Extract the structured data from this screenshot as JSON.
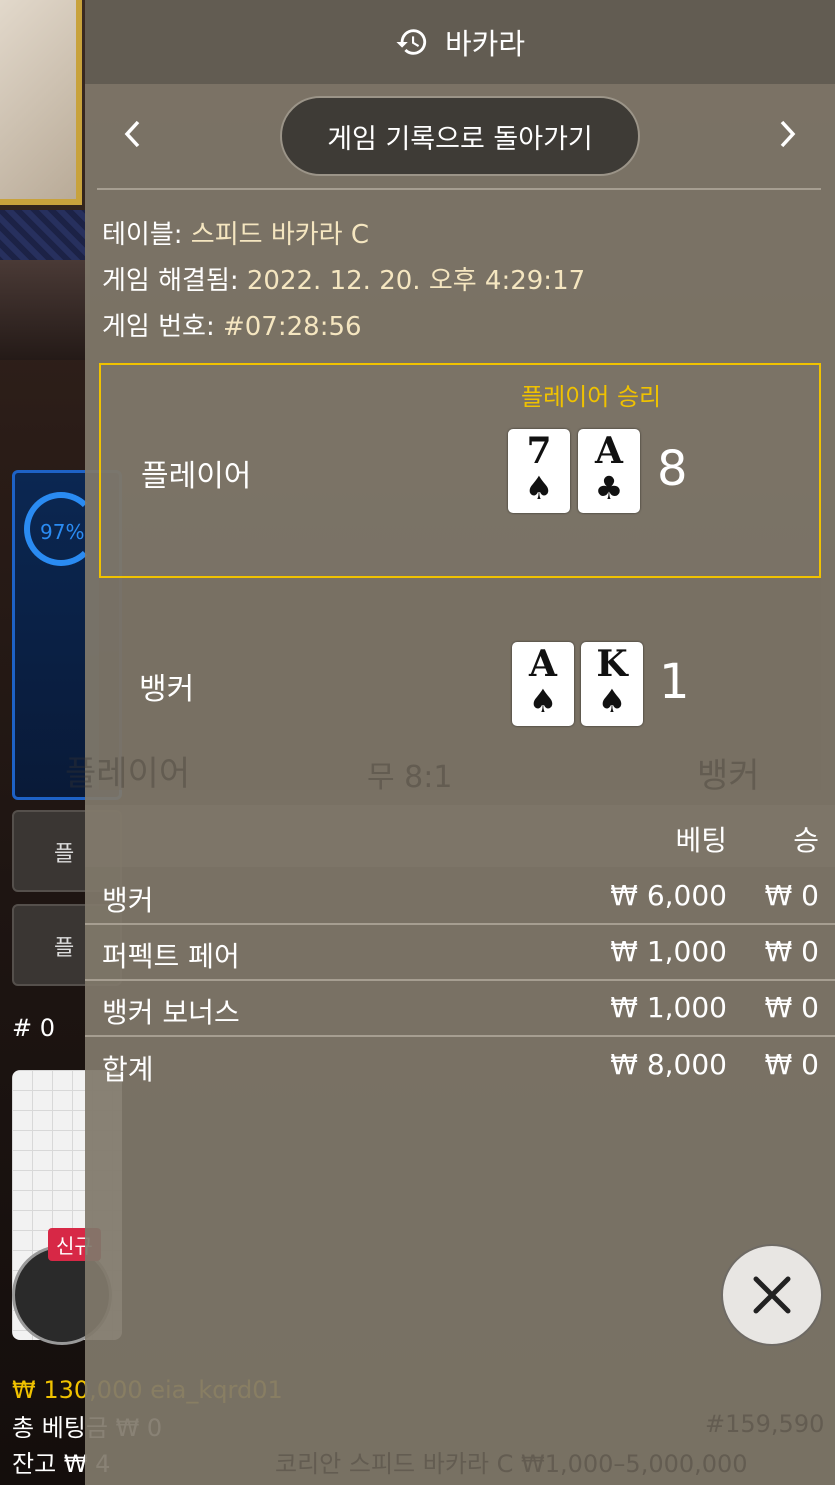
{
  "background": {
    "percent": "97%",
    "side_buttons": [
      "플레이어 보너스",
      "플레이어 페어"
    ],
    "hash_label": "# 0",
    "new_tag": "신규",
    "balance_line": "₩ 130,000 eia_kqrd01",
    "total_bet_line": "총 베팅금 ₩ 0",
    "remaining_line": "잔고 ₩ 4",
    "ghost_texts": {
      "player": "플레이어",
      "tie": "무 8:1",
      "banker": "뱅커",
      "table_limit": "코리안 스피드 바카라 C ₩1,000–5,000,000",
      "game_no": "#159,590"
    }
  },
  "panel": {
    "title": "바카라",
    "title_icon": "history-icon",
    "back_button_label": "게임 기록으로 돌아가기",
    "info": [
      {
        "label": "테이블:",
        "value": "스피드 바카라 C"
      },
      {
        "label": "게임 해결됨:",
        "value": "2022. 12. 20. 오후 4:29:17"
      },
      {
        "label": "게임 번호:",
        "value": "#07:28:56"
      }
    ],
    "player": {
      "label": "플레이어",
      "result": "플레이어 승리",
      "cards": [
        {
          "rank": "7",
          "suit": "♠"
        },
        {
          "rank": "A",
          "suit": "♣"
        }
      ],
      "score": "8"
    },
    "banker": {
      "label": "뱅커",
      "cards": [
        {
          "rank": "A",
          "suit": "♠"
        },
        {
          "rank": "K",
          "suit": "♠"
        }
      ],
      "score": "1"
    },
    "bets": {
      "header_bet": "베팅",
      "header_win": "승",
      "rows": [
        {
          "name": "뱅커",
          "amount": "₩ 6,000",
          "win": "₩ 0"
        },
        {
          "name": "퍼펙트 페어",
          "amount": "₩ 1,000",
          "win": "₩ 0"
        },
        {
          "name": "뱅커 보너스",
          "amount": "₩ 1,000",
          "win": "₩ 0"
        }
      ],
      "total": {
        "name": "합계",
        "amount": "₩ 8,000",
        "win": "₩ 0"
      }
    },
    "colors": {
      "winner_border": "#f0c200",
      "panel_bg": "#807a6a"
    }
  }
}
